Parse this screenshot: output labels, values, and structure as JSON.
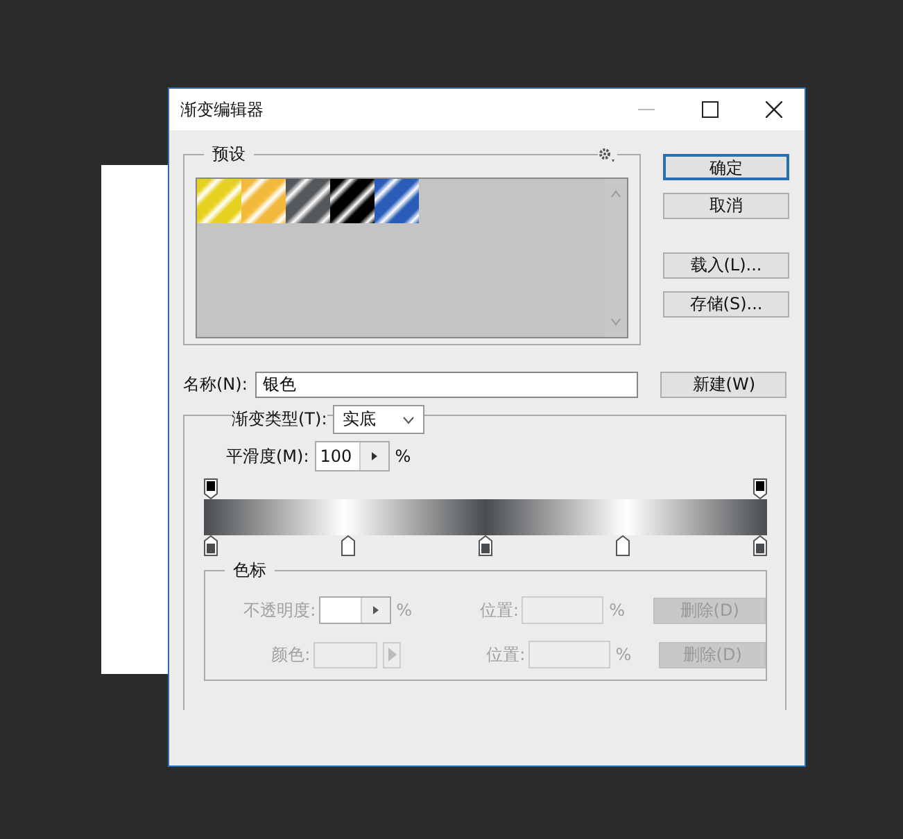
{
  "window": {
    "title": "渐变编辑器"
  },
  "presets": {
    "label": "预设",
    "swatches": [
      {
        "color": "#e6d21e"
      },
      {
        "color": "#f2b93a"
      },
      {
        "color": "#55585b"
      },
      {
        "color": "#000000"
      },
      {
        "color": "#2a5cb8"
      }
    ]
  },
  "buttons": [
    {
      "label": "确定",
      "default": true
    },
    {
      "label": "取消",
      "default": false
    },
    {
      "label": "载入(L)...",
      "default": false
    },
    {
      "label": "存储(S)...",
      "default": false
    }
  ],
  "name": {
    "label": "名称(N):",
    "value": "银色",
    "button": "新建(W)"
  },
  "gradient_type": {
    "label": "渐变类型(T):",
    "value": "实底"
  },
  "smoothness": {
    "label": "平滑度(M):",
    "value": "100",
    "unit": "%"
  },
  "opacity_stops": [
    {
      "color": "#000000"
    },
    {
      "color": "#000000"
    }
  ],
  "color_stops": [
    {
      "color": "#4a4d50"
    },
    {
      "color": "#ffffff"
    },
    {
      "color": "#4a4d50"
    },
    {
      "color": "#ffffff"
    },
    {
      "color": "#4a4d50"
    }
  ],
  "stops_group": {
    "label": "色标",
    "rows": [
      {
        "kind": "opacity",
        "label": "不透明度:",
        "unit": "%",
        "position_label": "位置:",
        "position_unit": "%",
        "delete": "删除(D)",
        "disabled": true
      },
      {
        "kind": "color",
        "label": "颜色:",
        "position_label": "位置:",
        "position_unit": "%",
        "delete": "删除(D)",
        "disabled": true
      }
    ]
  }
}
